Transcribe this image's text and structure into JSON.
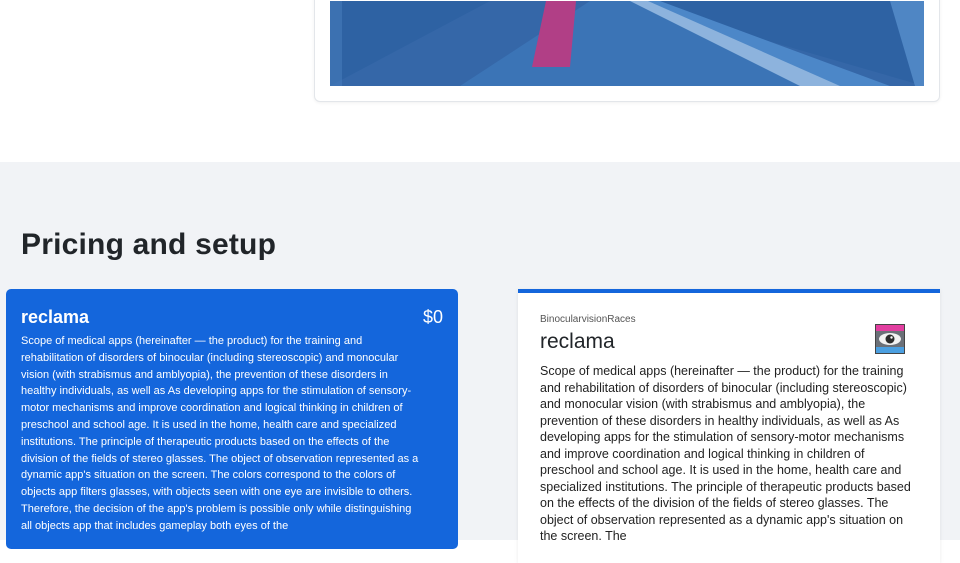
{
  "media": {
    "colors": {
      "background": "#2e62a3",
      "road": "#3d76b8",
      "marker": "#b13f86"
    }
  },
  "pricing": {
    "title": "Pricing and setup",
    "plan": {
      "name": "reclama",
      "price": "$0",
      "description": "Scope of medical apps (hereinafter — the product) for the training and rehabilitation of disorders of binocular (including stereoscopic) and monocular vision (with strabismus and amblyopia), the prevention of these disorders in healthy individuals, as well as As developing apps for the stimulation of sensory-motor mechanisms and improve coordination and logical thinking in children of preschool and school age. It is used in the home, health care and specialized institutions. The principle of therapeutic products based on the effects of the division of the fields of stereo glasses. The object of observation represented as a dynamic app's situation on the screen. The colors correspond to the colors of objects app filters glasses, with objects seen with one eye are invisible to others. Therefore, the decision of the app's problem is possible only while distinguishing all objects app that includes gameplay both eyes of the"
    },
    "app_card": {
      "company": "BinocularvisionRaces",
      "name": "reclama",
      "description": "Scope of medical apps (hereinafter — the product) for the training and rehabilitation of disorders of binocular (including stereoscopic) and monocular vision (with strabismus and amblyopia), the prevention of these disorders in healthy individuals, as well as As developing apps for the stimulation of sensory-motor mechanisms and improve coordination and logical thinking in children of preschool and school age. It is used in the home, health care and specialized institutions. The principle of therapeutic products based on the effects of the division of the fields of stereo glasses. The object of observation represented as a dynamic app's situation on the screen. The",
      "icon": "eye-icon"
    }
  },
  "colors": {
    "accent": "#1466dc",
    "section_bg": "#f1f3f6"
  }
}
